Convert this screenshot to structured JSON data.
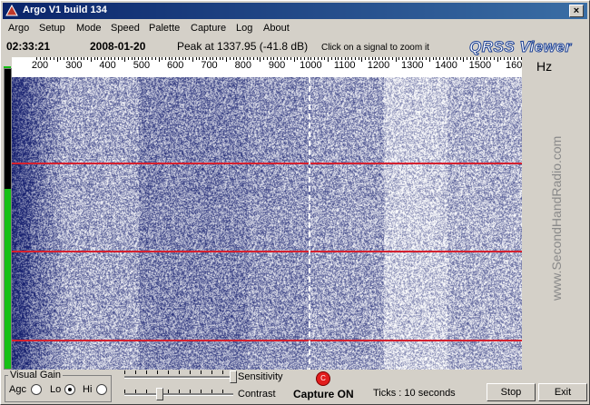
{
  "window": {
    "title": "Argo V1 build 134",
    "close_glyph": "×"
  },
  "menu": {
    "items": [
      "Argo",
      "Setup",
      "Mode",
      "Speed",
      "Palette",
      "Capture",
      "Log",
      "About"
    ]
  },
  "info": {
    "time": "02:33:21",
    "date": "2008-01-20",
    "peak": "Peak at 1337.95 (-41.8 dB)",
    "hint": "Click on a signal to zoom it",
    "logo": "QRSS Viewer"
  },
  "ruler": {
    "labels": [
      "200",
      "300",
      "400",
      "500",
      "600",
      "700",
      "800",
      "900",
      "1000",
      "1100",
      "1200",
      "1300",
      "1400",
      "1500",
      "160"
    ],
    "unit": "Hz"
  },
  "watermark": "www.SecondHandRadio.com",
  "controls": {
    "gain_legend": "Visual Gain",
    "agc_label": "Agc",
    "lo_label": "Lo",
    "hi_label": "Hi",
    "selected_gain": "Lo",
    "sensitivity_label": "Sensitivity",
    "contrast_label": "Contrast",
    "sensitivity_value": 1.0,
    "contrast_value": 0.3,
    "capture_led_glyph": "C",
    "capture_status": "Capture ON",
    "ticks_text": "Ticks  : 10 seconds",
    "stop_label": "Stop",
    "exit_label": "Exit"
  },
  "level_meter": {
    "level": 0.6
  },
  "colors": {
    "red_lines": "#d4212f",
    "waterfall_bg": "#1a2a7a",
    "level_green": "#16c016"
  }
}
